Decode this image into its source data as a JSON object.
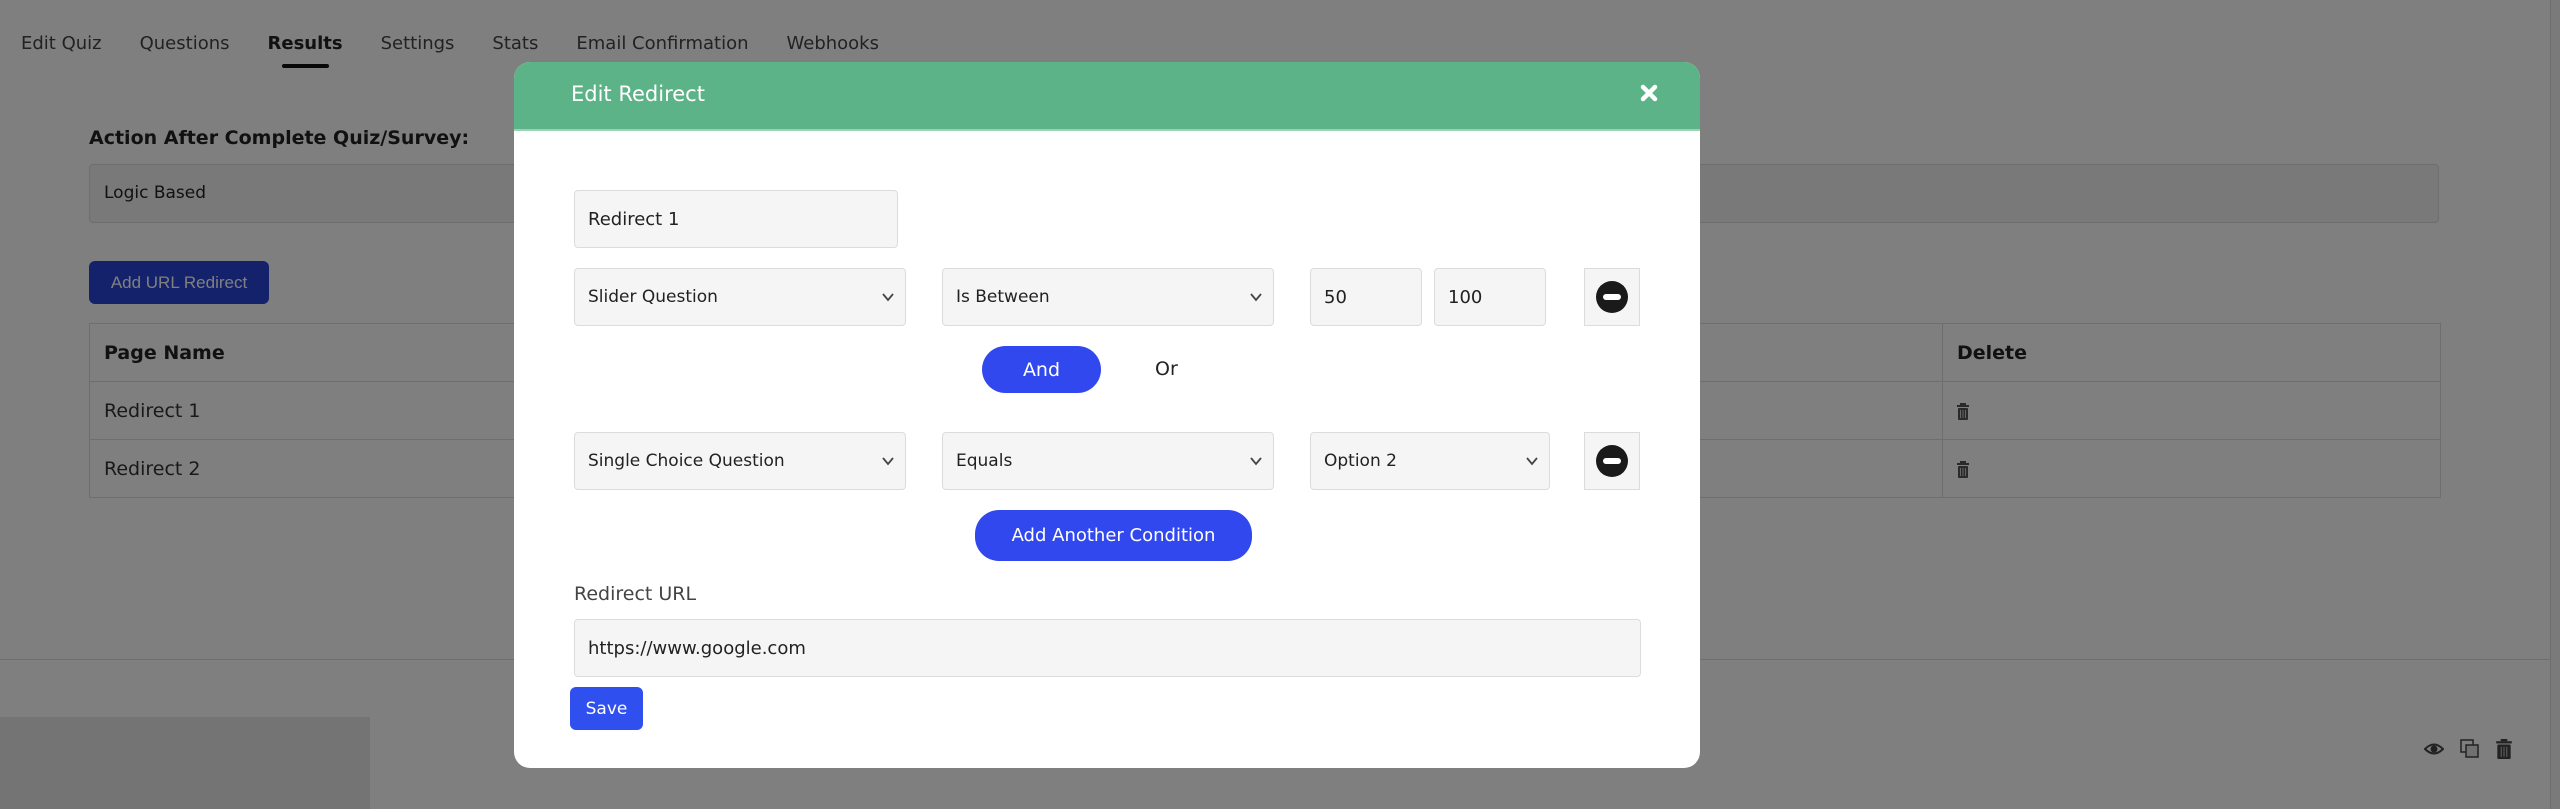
{
  "tabs": [
    {
      "label": "Edit Quiz",
      "active": false
    },
    {
      "label": "Questions",
      "active": false
    },
    {
      "label": "Results",
      "active": true
    },
    {
      "label": "Settings",
      "active": false
    },
    {
      "label": "Stats",
      "active": false
    },
    {
      "label": "Email Confirmation",
      "active": false
    },
    {
      "label": "Webhooks",
      "active": false
    }
  ],
  "results": {
    "action_label": "Action After Complete Quiz/Survey:",
    "action_value": "Logic Based",
    "add_button": "Add URL Redirect",
    "table": {
      "headers": [
        "Page Name",
        "Delete"
      ],
      "rows": [
        {
          "name": "Redirect 1",
          "delete_icon": "trash-icon"
        },
        {
          "name": "Redirect 2",
          "delete_icon": "trash-icon"
        }
      ]
    }
  },
  "lower_card": {
    "icons": [
      "eye-icon",
      "copy-icon",
      "trash-icon"
    ]
  },
  "modal": {
    "title": "Edit Redirect",
    "close_icon": "close-icon",
    "name_value": "Redirect 1",
    "conditions": [
      {
        "question": "Slider Question",
        "operator": "Is Between",
        "value_min": "50",
        "value_max": "100"
      },
      {
        "question": "Single Choice Question",
        "operator": "Equals",
        "value": "Option 2"
      }
    ],
    "connector": {
      "and_label": "And",
      "or_label": "Or",
      "selected": "And"
    },
    "add_condition_label": "Add Another Condition",
    "redirect_url_label": "Redirect URL",
    "redirect_url_value": "https://www.google.com",
    "save_label": "Save"
  },
  "colors": {
    "header_green": "#5cb388",
    "primary_blue": "#3048ee",
    "overlay": "rgba(0,0,0,0.5)"
  }
}
